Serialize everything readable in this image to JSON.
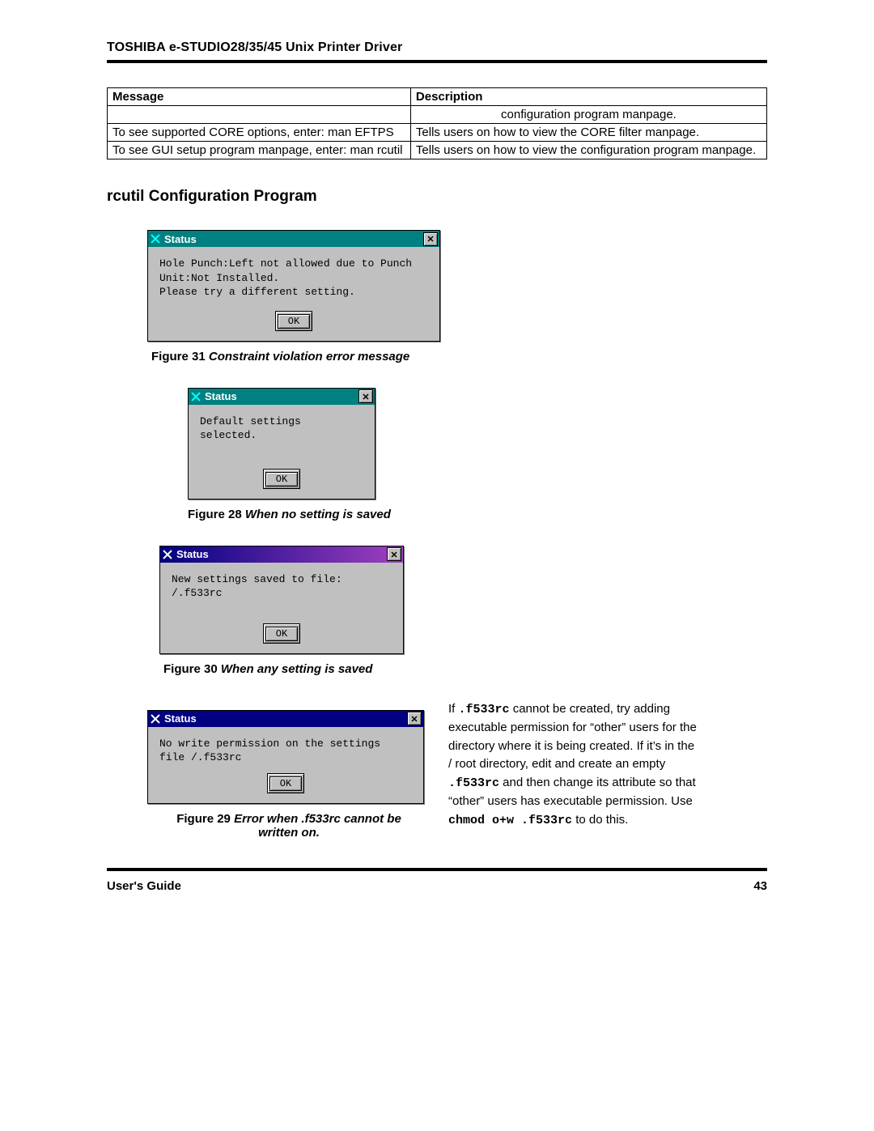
{
  "header": {
    "title": "TOSHIBA e-STUDIO28/35/45 Unix Printer Driver"
  },
  "table": {
    "cols": [
      "Message",
      "Description"
    ],
    "rows": [
      {
        "msg": "",
        "desc": "configuration program manpage."
      },
      {
        "msg": "To see supported CORE options, enter: man EFTPS",
        "desc": "Tells users on how to view the CORE filter manpage."
      },
      {
        "msg": "To see GUI setup program manpage, enter: man rcutil",
        "desc": "Tells users on how to view the configuration program manpage."
      }
    ]
  },
  "section_title": "rcutil Configuration Program",
  "dialogs": {
    "d1": {
      "title": "Status",
      "body": "Hole Punch:Left not allowed due to Punch Unit:Not Installed.\nPlease try a different setting.",
      "ok": "OK",
      "caption_label": "Figure 31",
      "caption_text": "Constraint violation error message"
    },
    "d2": {
      "title": "Status",
      "body": "Default settings selected.",
      "ok": "OK",
      "caption_label": "Figure 28",
      "caption_text": "When no setting is saved"
    },
    "d3": {
      "title": "Status",
      "body": "New settings saved to file: /.f533rc",
      "ok": "OK",
      "caption_label": "Figure 30",
      "caption_text": "When any setting is saved"
    },
    "d4": {
      "title": "Status",
      "body": "No write permission on the settings file /.f533rc",
      "ok": "OK",
      "caption_label": "Figure 29",
      "caption_text": "Error when .f533rc cannot be written on."
    }
  },
  "right_para": {
    "p1": "If ",
    "c1": ".f533rc",
    "p2": " cannot be created, try adding executable permission for “other” users for the directory where it is being created. If it’s in the / root directory, edit and create an empty ",
    "c2": ".f533rc",
    "p3": " and then change its attribute so that “other” users has executable permission. Use ",
    "c3": "chmod o+w .f533rc",
    "p4": " to do this."
  },
  "footer": {
    "left": "User's Guide",
    "right": "43"
  }
}
